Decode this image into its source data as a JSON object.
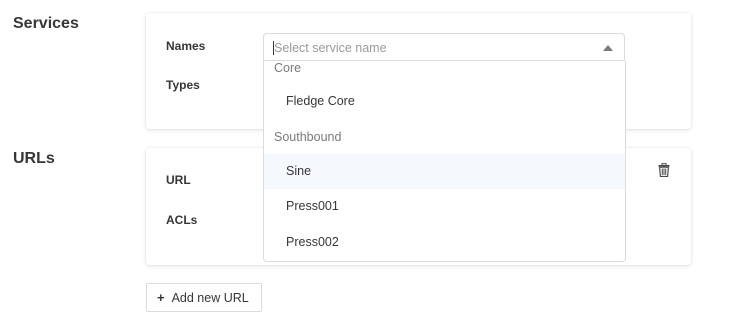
{
  "services": {
    "section_label": "Services",
    "names_label": "Names",
    "types_label": "Types",
    "select": {
      "placeholder": "Select service name"
    }
  },
  "dropdown": {
    "groups": [
      {
        "label": "Core",
        "options": [
          "Fledge Core"
        ]
      },
      {
        "label": "Southbound",
        "options": [
          "Sine",
          "Press001",
          "Press002"
        ]
      }
    ],
    "hovered_option": "Sine"
  },
  "urls": {
    "section_label": "URLs",
    "url_label": "URL",
    "acls_label": "ACLs"
  },
  "add_button": {
    "icon": "plus-icon",
    "label": "Add new URL"
  },
  "icons": {
    "delete": "trash-icon",
    "select_arrow": "chevron-up-icon"
  },
  "colors": {
    "hover_bg": "#f5f8fd",
    "border": "#dbdbdb",
    "text": "#363636",
    "muted": "#7a7a7a"
  }
}
